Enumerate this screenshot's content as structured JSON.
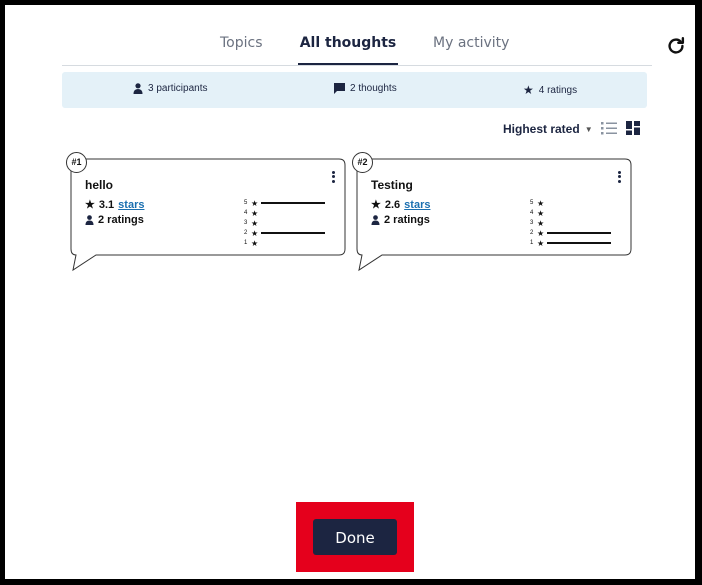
{
  "tabs": {
    "topics": "Topics",
    "all_thoughts": "All thoughts",
    "my_activity": "My activity"
  },
  "stats": {
    "participants": "3 participants",
    "thoughts": "2 thoughts",
    "ratings": "4 ratings"
  },
  "sort": {
    "label": "Highest rated"
  },
  "cards": [
    {
      "rank": "#1",
      "title": "hello",
      "avg": "3.1",
      "avg_link": "stars",
      "ratings": "2 ratings",
      "distribution": [
        {
          "stars": "5",
          "fraction": 1.0
        },
        {
          "stars": "4",
          "fraction": 0
        },
        {
          "stars": "3",
          "fraction": 0
        },
        {
          "stars": "2",
          "fraction": 1.0
        },
        {
          "stars": "1",
          "fraction": 0
        }
      ]
    },
    {
      "rank": "#2",
      "title": "Testing",
      "avg": "2.6",
      "avg_link": "stars",
      "ratings": "2 ratings",
      "distribution": [
        {
          "stars": "5",
          "fraction": 0
        },
        {
          "stars": "4",
          "fraction": 0
        },
        {
          "stars": "3",
          "fraction": 0
        },
        {
          "stars": "2",
          "fraction": 1.0
        },
        {
          "stars": "1",
          "fraction": 1.0
        }
      ]
    }
  ],
  "done_label": "Done",
  "colors": {
    "navy": "#1c2541",
    "stats_bg": "#e4f1f8",
    "highlight": "#e5001c",
    "link": "#1a6fb0"
  }
}
